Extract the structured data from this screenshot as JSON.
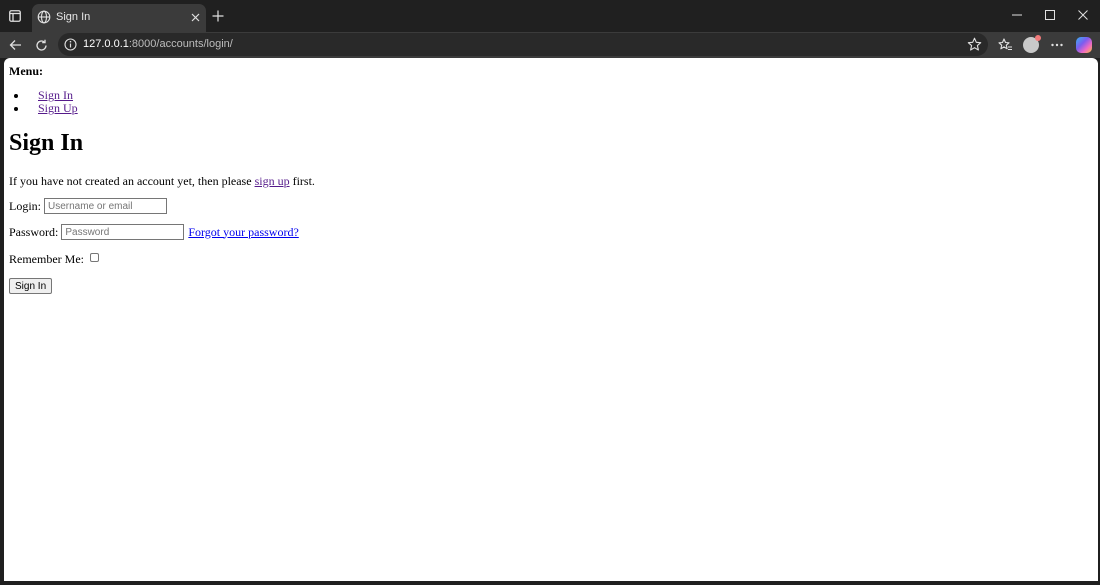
{
  "browser": {
    "tab": {
      "title": "Sign In",
      "icon": "globe-icon"
    },
    "address": {
      "host": "127.0.0.1",
      "rest": ":8000/accounts/login/"
    },
    "icons": [
      "sidebar-icon",
      "new-tab-icon",
      "minimize-icon",
      "maximize-icon",
      "close-window-icon",
      "back-icon",
      "refresh-icon",
      "info-icon",
      "favorite-star-icon",
      "favorites-icon",
      "profile-avatar",
      "more-icon",
      "copilot-icon"
    ]
  },
  "page": {
    "menu": {
      "title": "Menu:",
      "items": [
        {
          "label": "Sign In"
        },
        {
          "label": "Sign Up"
        }
      ]
    },
    "heading": "Sign In",
    "intro": {
      "before": "If you have not created an account yet, then please",
      "link": "sign up",
      "after": "first."
    },
    "login": {
      "label": "Login:",
      "placeholder": "Username or email",
      "value": ""
    },
    "password": {
      "label": "Password:",
      "placeholder": "Password",
      "value": "",
      "forgot_link": "Forgot your password?"
    },
    "remember": {
      "label": "Remember Me:",
      "checked": false
    },
    "submit_label": "Sign In"
  },
  "colors": {
    "chrome_dark": "#202020",
    "chrome_toolbar": "#3b3b3b",
    "visited_link": "#551a8b",
    "link": "#0000ee"
  }
}
